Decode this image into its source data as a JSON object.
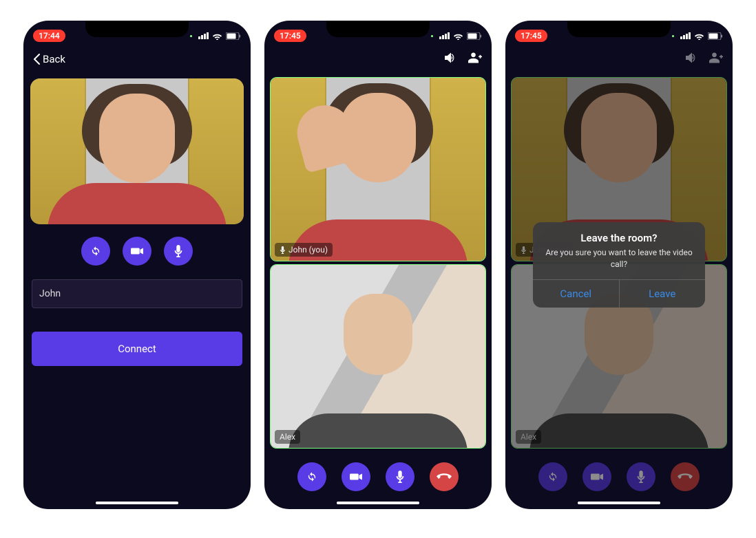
{
  "status": {
    "time1": "17:44",
    "time2": "17:45",
    "time3": "17:45"
  },
  "screen1": {
    "back_label": "Back",
    "name_value": "John",
    "connect_label": "Connect"
  },
  "screen2": {
    "tile1_label": "John (you)",
    "tile2_label": "Alex"
  },
  "screen3": {
    "tile1_label": "John (you)",
    "tile2_label": "Alex",
    "alert": {
      "title": "Leave the room?",
      "message": "Are you sure you want to leave the video call?",
      "cancel": "Cancel",
      "leave": "Leave"
    }
  },
  "icons": {
    "switch": "switch-camera",
    "video": "video",
    "mic": "mic",
    "hangup": "hangup",
    "speaker": "speaker",
    "add_user": "add-user"
  }
}
